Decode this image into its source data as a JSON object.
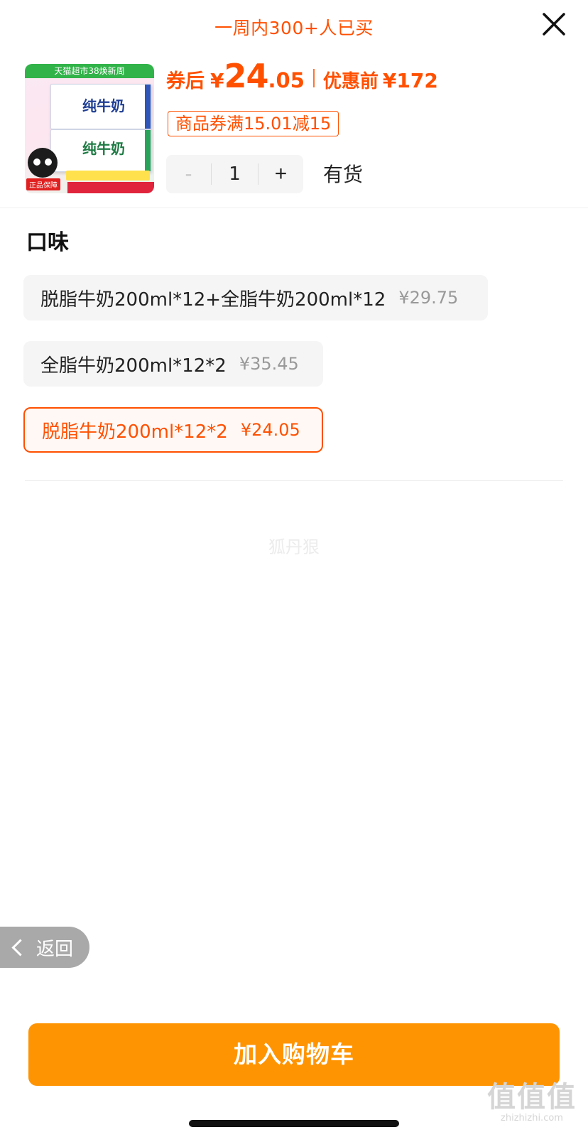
{
  "header": {
    "sold_text": "一周内300+人已买"
  },
  "product": {
    "image": {
      "top_banner": "天猫超市38焕新周",
      "carton_text": "纯牛奶",
      "badge": "正品保障"
    },
    "price": {
      "prefix": "券后",
      "currency": "¥",
      "integer": "24",
      "decimal": ".05",
      "original_label": "优惠前",
      "original_value": "¥172"
    },
    "coupon": "商品券满15.01减15",
    "quantity": {
      "minus": "-",
      "value": "1",
      "plus": "+"
    },
    "stock": "有货"
  },
  "flavor": {
    "title": "口味",
    "options": [
      {
        "name": "脱脂牛奶200ml*12+全脂牛奶200ml*12",
        "price": "¥29.75",
        "selected": false
      },
      {
        "name": "全脂牛奶200ml*12*2",
        "price": "¥35.45",
        "selected": false
      },
      {
        "name": "脱脂牛奶200ml*12*2",
        "price": "¥24.05",
        "selected": true
      }
    ]
  },
  "watermark_text": "狐丹狠",
  "back_label": "返回",
  "add_to_cart_label": "加入购物车",
  "site_mark": {
    "logo": "值值值",
    "url": "zhizhizhi.com"
  },
  "colors": {
    "accent": "#ff5000",
    "cart_button": "#ff9402",
    "option_bg": "#f5f5f5"
  },
  "icons": [
    "close-icon",
    "chevron-left-icon"
  ]
}
